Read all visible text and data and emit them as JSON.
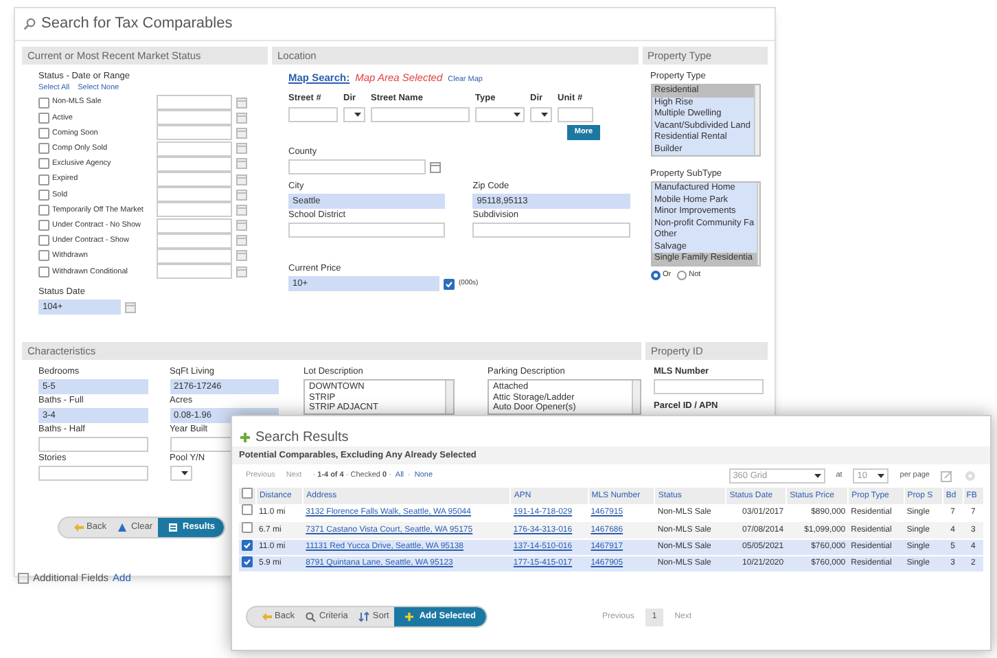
{
  "window": {
    "title": "Search for Tax Comparables"
  },
  "market_status": {
    "heading": "Current or Most Recent Market Status",
    "label": "Status - Date or Range",
    "select_all": "Select All",
    "select_none": "Select None",
    "statuses": [
      {
        "label": "Non-MLS Sale",
        "checked": false
      },
      {
        "label": "Active",
        "checked": false
      },
      {
        "label": "Coming Soon",
        "checked": false
      },
      {
        "label": "Comp Only Sold",
        "checked": false
      },
      {
        "label": "Exclusive Agency",
        "checked": false
      },
      {
        "label": "Expired",
        "checked": false
      },
      {
        "label": "Sold",
        "checked": false
      },
      {
        "label": "Temporarily Off The Market",
        "checked": false
      },
      {
        "label": "Under Contract - No Show",
        "checked": false
      },
      {
        "label": "Under Contract - Show",
        "checked": false
      },
      {
        "label": "Withdrawn",
        "checked": false
      },
      {
        "label": "Withdrawn Conditional",
        "checked": false
      }
    ],
    "status_date": {
      "label": "Status Date",
      "value": "104+"
    }
  },
  "location": {
    "heading": "Location",
    "map_search": "Map Search:",
    "map_state": "Map Area Selected",
    "clear_map": "Clear Map",
    "street_fields": [
      {
        "label": "Street #",
        "kind": "text"
      },
      {
        "label": "Dir",
        "kind": "select"
      },
      {
        "label": "Street Name",
        "kind": "text"
      },
      {
        "label": "Type",
        "kind": "select"
      },
      {
        "label": "Dir",
        "kind": "select"
      },
      {
        "label": "Unit #",
        "kind": "text"
      }
    ],
    "more_button": "More",
    "county": {
      "label": "County"
    },
    "city": {
      "label": "City",
      "value": "Seattle"
    },
    "zip_code": {
      "label": "Zip Code",
      "value": "95118,95113"
    },
    "school_district": {
      "label": "School District"
    },
    "subdivision": {
      "label": "Subdivision"
    },
    "current_price": {
      "label": "Current Price",
      "value": "10+"
    },
    "thousands": {
      "label": "(000s)",
      "checked": true
    }
  },
  "property_type": {
    "heading": "Property Type",
    "type_label": "Property Type",
    "types": [
      {
        "label": "Residential",
        "selected": true
      },
      {
        "label": "High Rise",
        "selected": false
      },
      {
        "label": "Multiple Dwelling",
        "selected": false
      },
      {
        "label": "Vacant/Subdivided Land",
        "selected": false
      },
      {
        "label": "Residential Rental",
        "selected": false
      },
      {
        "label": "Builder",
        "selected": false
      }
    ],
    "subtype_label": "Property SubType",
    "subtypes": [
      {
        "label": "Manufactured Home",
        "selected": false
      },
      {
        "label": "Mobile Home Park",
        "selected": false
      },
      {
        "label": "Minor Improvements",
        "selected": false
      },
      {
        "label": "Non-profit Community Fa",
        "selected": false
      },
      {
        "label": "Other",
        "selected": false
      },
      {
        "label": "Salvage",
        "selected": false
      },
      {
        "label": "Single Family Residentia",
        "selected": true
      }
    ],
    "match": [
      {
        "label": "Or",
        "selected": true
      },
      {
        "label": "Not",
        "selected": false
      }
    ]
  },
  "characteristics": {
    "heading": "Characteristics",
    "fields": [
      {
        "label": "Bedrooms",
        "kind": "text",
        "value": "5-5"
      },
      {
        "label": "SqFt Living",
        "kind": "text",
        "value": "2176-17246"
      },
      {
        "label": "Baths - Full",
        "kind": "text",
        "value": "3-4"
      },
      {
        "label": "Acres",
        "kind": "text",
        "value": "0.08-1.96"
      },
      {
        "label": "Baths - Half",
        "kind": "text"
      },
      {
        "label": "Year Built",
        "kind": "text"
      },
      {
        "label": "Stories",
        "kind": "text"
      },
      {
        "label": "Pool Y/N",
        "kind": "select"
      }
    ],
    "lot_description": {
      "label": "Lot Description",
      "options": [
        "DOWNTOWN",
        "STRIP",
        "STRIP ADJACNT"
      ]
    },
    "parking_description": {
      "label": "Parking Description",
      "options": [
        "Attached",
        "Attic Storage/Ladder",
        "Auto Door Opener(s)"
      ]
    }
  },
  "property_id": {
    "heading": "Property ID",
    "fields": [
      {
        "label": "MLS Number"
      },
      {
        "label": "Parcel ID / APN"
      }
    ]
  },
  "buttons": [
    {
      "label": "Back",
      "kind": "back"
    },
    {
      "label": "Clear",
      "kind": "clear"
    },
    {
      "label": "Results",
      "kind": "results"
    }
  ],
  "additional_fields": {
    "label": "Additional Fields",
    "link": "Add"
  },
  "results": {
    "title": "Search Results",
    "subtitle": "Potential Comparables, Excluding Any Already Selected",
    "nav": {
      "previous": "Previous",
      "next": "Next",
      "summary": "· **1-4 of 4** · Checked **0** ·",
      "all": "All",
      "separator": "·",
      "none": "None"
    },
    "view": "360 Grid",
    "at": "at",
    "per_page_value": "10",
    "per_page": "per page",
    "select_all_checked": false,
    "columns": [
      "Distance",
      "Address",
      "APN",
      "MLS Number",
      "Status",
      "Status Date",
      "Status Price",
      "Prop Type",
      "Prop S",
      "Bd",
      "FB"
    ],
    "rows": [
      {
        "checked": false,
        "cells": [
          "11.0 mi",
          "3132 Florence Falls Walk, Seattle, WA 95044",
          "191-14-718-029",
          "1467915",
          "Non-MLS Sale",
          "03/01/2017",
          "$890,000",
          "Residential",
          "Single",
          "7",
          "7"
        ]
      },
      {
        "checked": false,
        "cells": [
          "6.7 mi",
          "7371 Castano Vista Court, Seattle, WA 95175",
          "176-34-313-016",
          "1467686",
          "Non-MLS Sale",
          "07/08/2014",
          "$1,099,000",
          "Residential",
          "Single",
          "4",
          "3"
        ]
      },
      {
        "checked": true,
        "cells": [
          "11.0 mi",
          "11131 Red Yucca Drive, Seattle, WA 95138",
          "137-14-510-016",
          "1467917",
          "Non-MLS Sale",
          "05/05/2021",
          "$760,000",
          "Residential",
          "Single",
          "5",
          "4"
        ]
      },
      {
        "checked": true,
        "cells": [
          "5.9 mi",
          "8791 Quintana Lane, Seattle, WA 95123",
          "177-15-415-017",
          "1467905",
          "Non-MLS Sale",
          "10/21/2020",
          "$760,000",
          "Residential",
          "Single",
          "3",
          "2"
        ]
      }
    ],
    "buttons": [
      {
        "label": "Back",
        "kind": "back"
      },
      {
        "label": "Criteria",
        "kind": "criteria"
      },
      {
        "label": "Sort",
        "kind": "sort"
      },
      {
        "label": "Add Selected",
        "kind": "add"
      }
    ],
    "pager": {
      "previous": "Previous",
      "page": "1",
      "next": "Next"
    }
  }
}
